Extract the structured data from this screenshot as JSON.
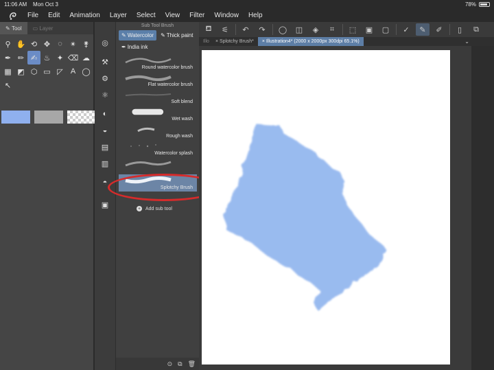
{
  "status": {
    "time": "11:06 AM",
    "date": "Mon Oct 3",
    "battery": "78%"
  },
  "menu": [
    "File",
    "Edit",
    "Animation",
    "Layer",
    "Select",
    "View",
    "Filter",
    "Window",
    "Help"
  ],
  "tool_panel": {
    "tabs": [
      "Tool",
      "Layer"
    ]
  },
  "subtool_panel": {
    "title": "Sub Tool Brush",
    "tabs": [
      "Watercolor",
      "Thick paint",
      "India ink"
    ],
    "brushes": [
      "Round watercolor brush",
      "Flat watercolor brush",
      "Soft blend",
      "Wet wash",
      "Rough wash",
      "Watercolor splash",
      "Splotchy Brush"
    ],
    "selected_brush": "Splotchy Brush",
    "add_label": "Add sub tool"
  },
  "document": {
    "tab_stub": "Illo",
    "tab1": "Splotchy Brush*",
    "tab2": "Illustration4* (2000 x 2000px 300dpi 65.1%)"
  },
  "colors": {
    "accent": "#5b7fa9",
    "highlight": "#d62b2b",
    "paint": "#8fb4ee",
    "swatch_main": "#8fb0ee"
  }
}
